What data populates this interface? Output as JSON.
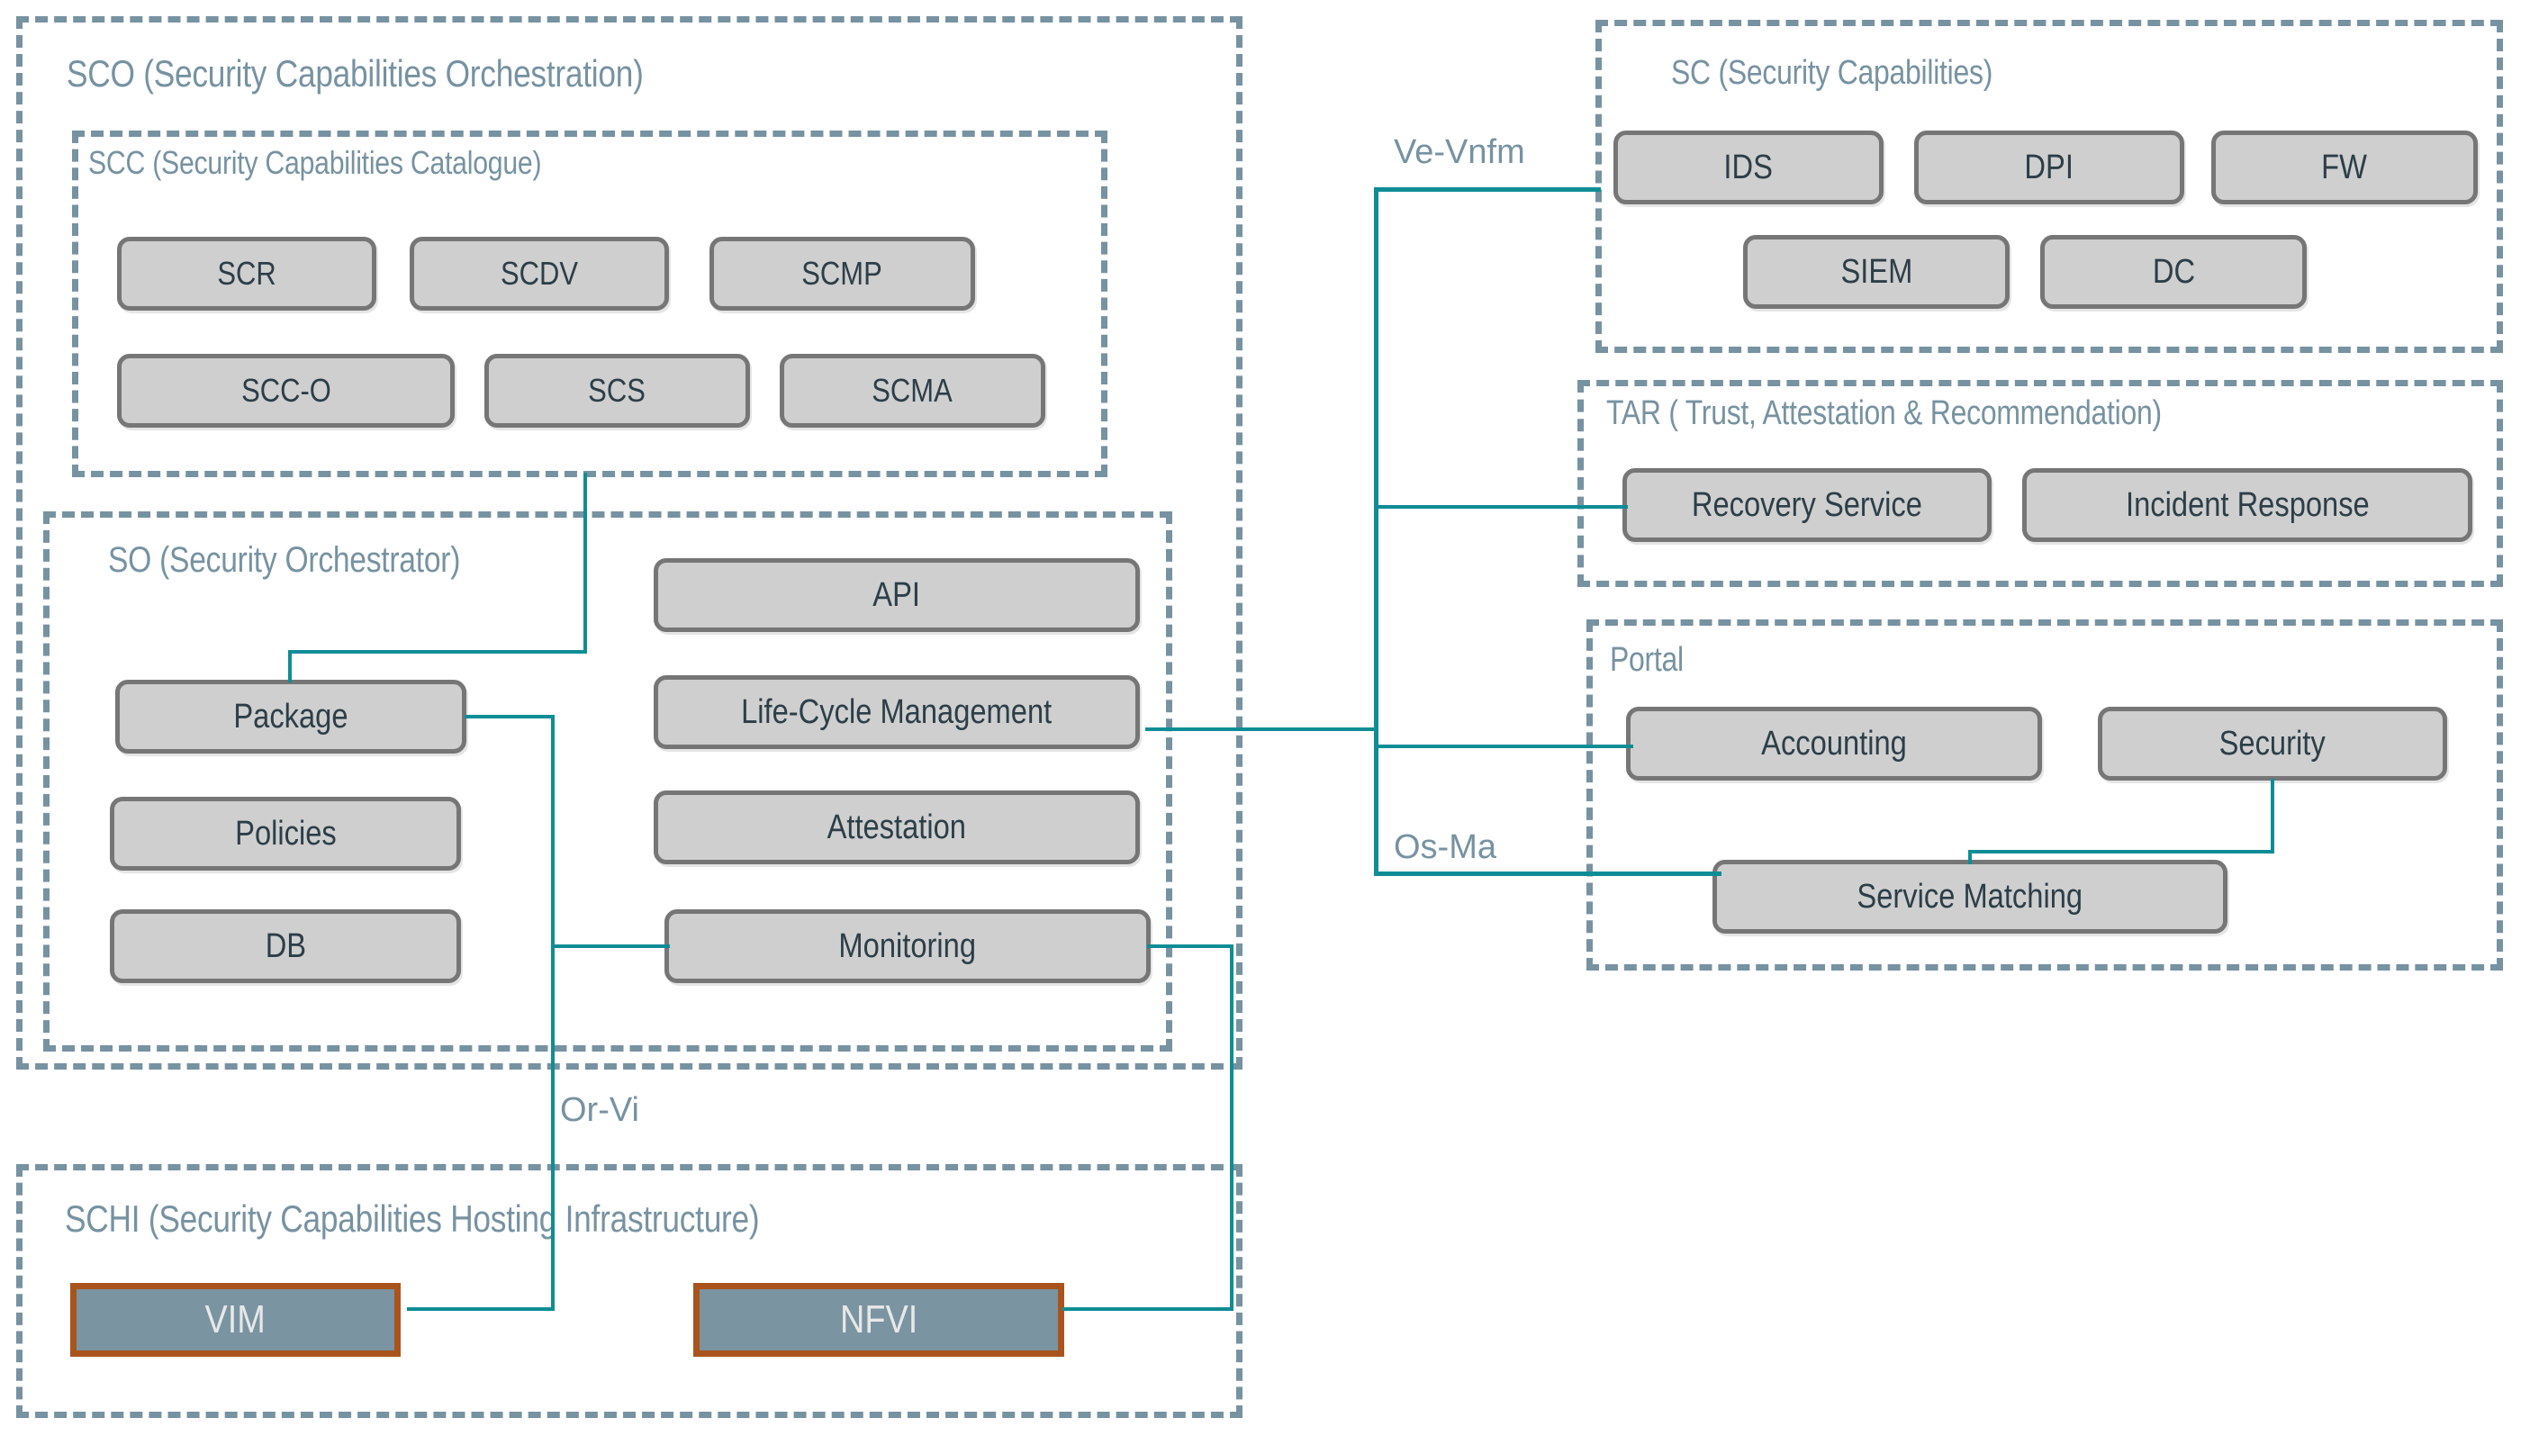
{
  "diagram": {
    "title": "Security Capabilities Orchestration Architecture",
    "colors": {
      "group_border": "#7792a1",
      "group_title": "#7792a1",
      "box_fill": "#cfcfcf",
      "box_border": "#767676",
      "box_text": "#2c3e48",
      "link": "#0f8d96",
      "infra_fill": "#7a94a2",
      "infra_border": "#a9541c",
      "infra_text": "#e8e8e8",
      "background": "#ffffff"
    }
  },
  "groups": {
    "sco": {
      "title": "SCO (Security Capabilities Orchestration)"
    },
    "scc": {
      "title": "SCC (Security Capabilities Catalogue)"
    },
    "so": {
      "title": "SO (Security Orchestrator)"
    },
    "schi": {
      "title": "SCHI (Security Capabilities Hosting Infrastructure)"
    },
    "sc": {
      "title": "SC (Security Capabilities)"
    },
    "tar": {
      "title": "TAR ( Trust, Attestation & Recommendation)"
    },
    "portal": {
      "title": "Portal"
    }
  },
  "boxes": {
    "scc": [
      {
        "label": "SCR"
      },
      {
        "label": "SCDV"
      },
      {
        "label": "SCMP"
      },
      {
        "label": "SCC-O"
      },
      {
        "label": "SCS"
      },
      {
        "label": "SCMA"
      }
    ],
    "so_left": [
      {
        "label": "Package"
      },
      {
        "label": "Policies"
      },
      {
        "label": "DB"
      }
    ],
    "so_right": [
      {
        "label": "API"
      },
      {
        "label": "Life-Cycle Management"
      },
      {
        "label": "Attestation"
      },
      {
        "label": "Monitoring"
      }
    ],
    "schi": [
      {
        "label": "VIM"
      },
      {
        "label": "NFVI"
      }
    ],
    "sc": [
      {
        "label": "IDS"
      },
      {
        "label": "DPI"
      },
      {
        "label": "FW"
      },
      {
        "label": "SIEM"
      },
      {
        "label": "DC"
      }
    ],
    "tar": [
      {
        "label": "Recovery Service"
      },
      {
        "label": "Incident Response"
      }
    ],
    "portal": [
      {
        "label": "Accounting"
      },
      {
        "label": "Security"
      },
      {
        "label": "Service Matching"
      }
    ]
  },
  "interfaces": [
    {
      "label": "Ve-Vnfm"
    },
    {
      "label": "Os-Ma"
    },
    {
      "label": "Or-Vi"
    }
  ]
}
